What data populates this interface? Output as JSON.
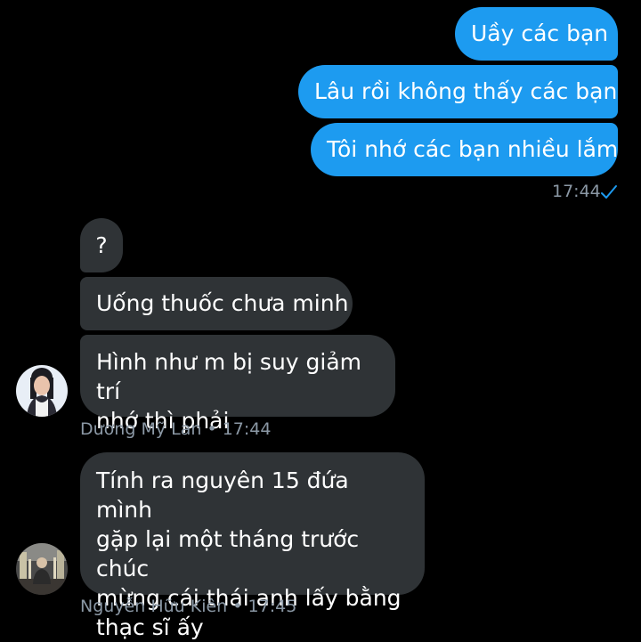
{
  "colors": {
    "background": "#000000",
    "sent_bubble": "#1d9bf0",
    "received_bubble": "#2f3336",
    "meta_text": "#8b98a5",
    "read_check": "#1d9bf0"
  },
  "outgoing": {
    "messages": [
      "Uầy các bạn",
      "Lâu rồi không thấy các bạn",
      "Tôi nhớ các bạn nhiều lắm"
    ],
    "time": "17:44",
    "status_icon": "check-icon"
  },
  "groups": [
    {
      "sender": "Dương Mỹ Lan",
      "time": "17:44",
      "separator": "•",
      "messages": [
        "?",
        "Uống thuốc chưa minh",
        "Hình như m bị suy giảm trí\nnhớ thì phải"
      ]
    },
    {
      "sender": "Nguyễn Hữu Kiên",
      "time": "17:45",
      "separator": "•",
      "messages": [
        "Tính ra nguyên 15 đứa mình\ngặp lại một tháng trước chúc\nmừng cái thái anh lấy bằng\nthạc sĩ ấy"
      ]
    }
  ]
}
